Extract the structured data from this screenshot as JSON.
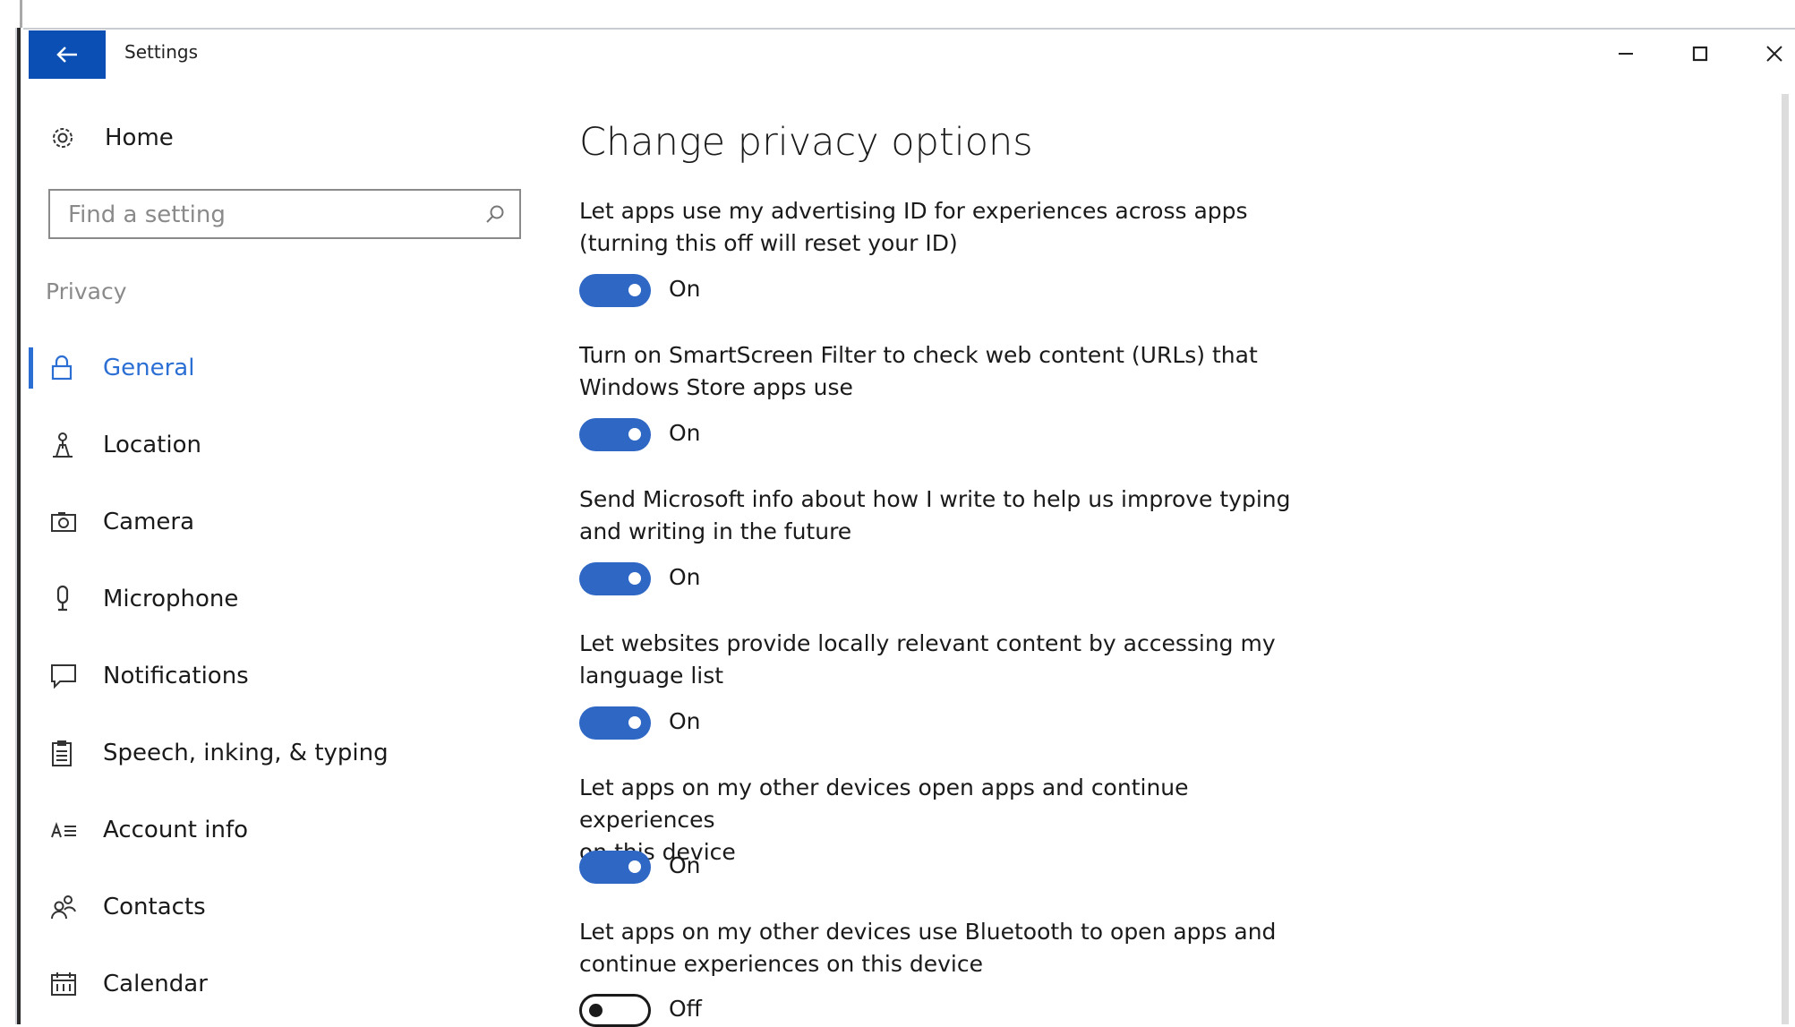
{
  "window": {
    "title": "Settings",
    "back_icon": "back-arrow-icon",
    "accent_color": "#0b4fb4"
  },
  "sidebar": {
    "home_label": "Home",
    "search_placeholder": "Find a setting",
    "section_label": "Privacy",
    "items": [
      {
        "label": "General",
        "icon": "lock-icon",
        "active": true
      },
      {
        "label": "Location",
        "icon": "location-icon"
      },
      {
        "label": "Camera",
        "icon": "camera-icon"
      },
      {
        "label": "Microphone",
        "icon": "microphone-icon"
      },
      {
        "label": "Notifications",
        "icon": "notification-icon"
      },
      {
        "label": "Speech, inking, & typing",
        "icon": "clipboard-icon"
      },
      {
        "label": "Account info",
        "icon": "account-info-icon"
      },
      {
        "label": "Contacts",
        "icon": "contacts-icon"
      },
      {
        "label": "Calendar",
        "icon": "calendar-icon"
      }
    ]
  },
  "main": {
    "title": "Change privacy options",
    "options": [
      {
        "line1": "Let apps use my advertising ID for experiences across apps",
        "line2": "(turning this off will reset your ID)",
        "state": "On"
      },
      {
        "line1": "Turn on SmartScreen Filter to check web content (URLs) that",
        "line2": "Windows Store apps use",
        "state": "On"
      },
      {
        "line1": "Send Microsoft info about how I write to help us improve typing",
        "line2": "and writing in the future",
        "state": "On"
      },
      {
        "line1": "Let websites provide locally relevant content by accessing my",
        "line2": "language list",
        "state": "On"
      },
      {
        "line1": "Let apps on my other devices open apps and continue experiences",
        "line2": "on this device",
        "state": "On"
      },
      {
        "line1": "Let apps on my other devices use Bluetooth to open apps and",
        "line2": "continue experiences on this device",
        "state": "Off"
      }
    ],
    "toggle_on_color": "#2e67c4"
  }
}
